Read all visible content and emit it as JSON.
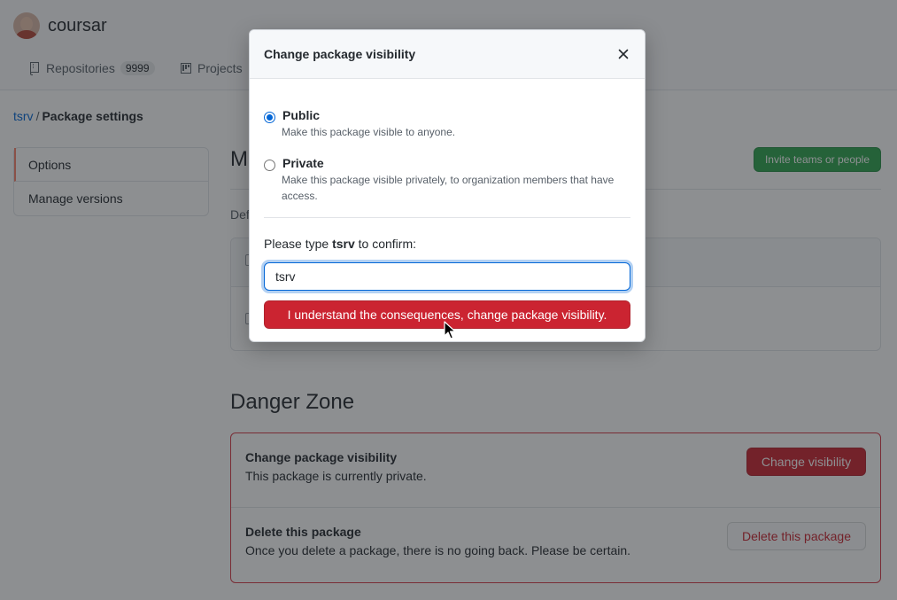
{
  "header": {
    "org_name": "coursar",
    "tabs": [
      {
        "label": "Repositories",
        "count": "9999",
        "icon": "repo-icon"
      },
      {
        "label": "Projects",
        "icon": "project-icon"
      }
    ]
  },
  "breadcrumb": {
    "package": "tsrv",
    "separator": "/",
    "page": "Package settings"
  },
  "sidebar": {
    "items": [
      {
        "label": "Options",
        "selected": true
      },
      {
        "label": "Manage versions",
        "selected": false
      }
    ]
  },
  "main": {
    "title_partial": "M",
    "default_text_partial": "Def",
    "invite_label": "Invite teams or people"
  },
  "danger_zone": {
    "title": "Danger Zone",
    "rows": [
      {
        "title": "Change package visibility",
        "description": "This package is currently private.",
        "button": "Change visibility"
      },
      {
        "title": "Delete this package",
        "description": "Once you delete a package, there is no going back. Please be certain.",
        "button": "Delete this package"
      }
    ]
  },
  "modal": {
    "title": "Change package visibility",
    "close_icon": "close-icon",
    "options": [
      {
        "label": "Public",
        "note": "Make this package visible to anyone.",
        "checked": true
      },
      {
        "label": "Private",
        "note": "Make this package visible privately, to organization members that have access.",
        "checked": false
      }
    ],
    "confirm_prefix": "Please type",
    "confirm_name": "tsrv",
    "confirm_suffix": "to confirm:",
    "input_value": "tsrv",
    "confirm_button": "I understand the consequences, change package visibility."
  },
  "colors": {
    "danger": "#cb2431",
    "primary": "#2ea44f",
    "link": "#0366d6",
    "selected_accent": "#f9826c"
  }
}
